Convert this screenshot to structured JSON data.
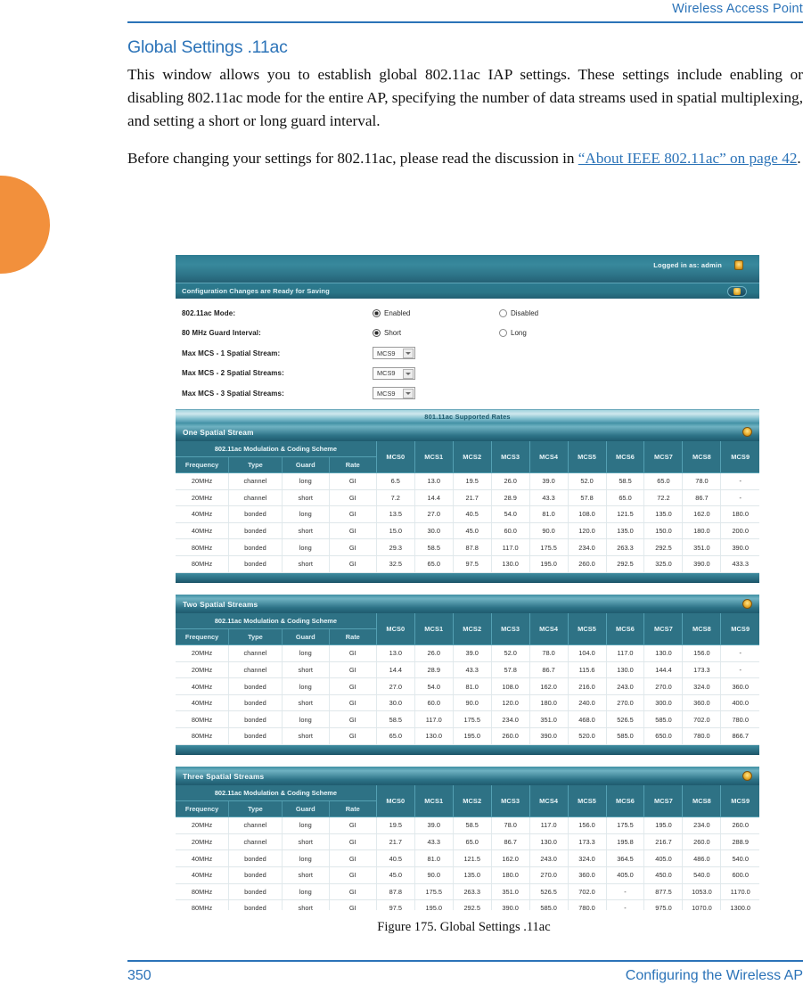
{
  "page": {
    "running_head": "Wireless Access Point",
    "section_title": "Global Settings .11ac",
    "paragraph_1": "This window allows you to establish global 802.11ac IAP settings. These settings include enabling or disabling 802.11ac mode for the entire AP, specifying the number of data streams used in spatial multiplexing, and setting a short or long guard interval.",
    "paragraph_2_pre": "Before changing your settings for 802.11ac, please read the discussion in ",
    "paragraph_2_link": "“About IEEE 802.11ac” on page 42",
    "paragraph_2_post": ".",
    "figure_caption": "Figure 175. Global Settings .11ac",
    "folio_number": "350",
    "folio_title": "Configuring the Wireless AP",
    "accent_color": "#2b73b8",
    "tab_color": "#f2903c"
  },
  "screenshot": {
    "topbar": {
      "logged_in_text": "Logged in as: admin",
      "lock_icon": "lock-icon"
    },
    "statusbar": {
      "text": "Configuration Changes are Ready for Saving",
      "save_button_icon": "save-icon"
    },
    "form": {
      "rows": [
        {
          "label": "802.11ac Mode:",
          "type": "radio",
          "options": [
            {
              "label": "Enabled",
              "selected": true
            },
            {
              "label": "Disabled",
              "selected": false
            }
          ]
        },
        {
          "label": "80 MHz Guard Interval:",
          "type": "radio",
          "options": [
            {
              "label": "Short",
              "selected": true
            },
            {
              "label": "Long",
              "selected": false
            }
          ]
        },
        {
          "label": "Max MCS - 1 Spatial Stream:",
          "type": "select",
          "value": "MCS9"
        },
        {
          "label": "Max MCS - 2 Spatial Streams:",
          "type": "select",
          "value": "MCS9"
        },
        {
          "label": "Max MCS - 3 Spatial Streams:",
          "type": "select",
          "value": "MCS9"
        }
      ]
    },
    "rates_banner": "801.11ac Supported Rates",
    "table_group_header": "802.11ac Modulation & Coding Scheme",
    "sub_headers": [
      "Frequency",
      "Type",
      "Guard",
      "Rate"
    ],
    "mcs_headers": [
      "MCS0",
      "MCS1",
      "MCS2",
      "MCS3",
      "MCS4",
      "MCS5",
      "MCS6",
      "MCS7",
      "MCS8",
      "MCS9"
    ],
    "sections": [
      {
        "title": "One Spatial Stream",
        "gear_icon": "gear-icon",
        "rows": [
          {
            "freq": "20MHz",
            "type": "channel",
            "guard": "long",
            "rate": "GI",
            "values": [
              "6.5",
              "13.0",
              "19.5",
              "26.0",
              "39.0",
              "52.0",
              "58.5",
              "65.0",
              "78.0",
              "-"
            ]
          },
          {
            "freq": "20MHz",
            "type": "channel",
            "guard": "short",
            "rate": "GI",
            "values": [
              "7.2",
              "14.4",
              "21.7",
              "28.9",
              "43.3",
              "57.8",
              "65.0",
              "72.2",
              "86.7",
              "-"
            ]
          },
          {
            "freq": "40MHz",
            "type": "bonded",
            "guard": "long",
            "rate": "GI",
            "values": [
              "13.5",
              "27.0",
              "40.5",
              "54.0",
              "81.0",
              "108.0",
              "121.5",
              "135.0",
              "162.0",
              "180.0"
            ]
          },
          {
            "freq": "40MHz",
            "type": "bonded",
            "guard": "short",
            "rate": "GI",
            "values": [
              "15.0",
              "30.0",
              "45.0",
              "60.0",
              "90.0",
              "120.0",
              "135.0",
              "150.0",
              "180.0",
              "200.0"
            ]
          },
          {
            "freq": "80MHz",
            "type": "bonded",
            "guard": "long",
            "rate": "GI",
            "values": [
              "29.3",
              "58.5",
              "87.8",
              "117.0",
              "175.5",
              "234.0",
              "263.3",
              "292.5",
              "351.0",
              "390.0"
            ]
          },
          {
            "freq": "80MHz",
            "type": "bonded",
            "guard": "short",
            "rate": "GI",
            "values": [
              "32.5",
              "65.0",
              "97.5",
              "130.0",
              "195.0",
              "260.0",
              "292.5",
              "325.0",
              "390.0",
              "433.3"
            ]
          }
        ]
      },
      {
        "title": "Two Spatial Streams",
        "gear_icon": "gear-icon",
        "rows": [
          {
            "freq": "20MHz",
            "type": "channel",
            "guard": "long",
            "rate": "GI",
            "values": [
              "13.0",
              "26.0",
              "39.0",
              "52.0",
              "78.0",
              "104.0",
              "117.0",
              "130.0",
              "156.0",
              "-"
            ]
          },
          {
            "freq": "20MHz",
            "type": "channel",
            "guard": "short",
            "rate": "GI",
            "values": [
              "14.4",
              "28.9",
              "43.3",
              "57.8",
              "86.7",
              "115.6",
              "130.0",
              "144.4",
              "173.3",
              "-"
            ]
          },
          {
            "freq": "40MHz",
            "type": "bonded",
            "guard": "long",
            "rate": "GI",
            "values": [
              "27.0",
              "54.0",
              "81.0",
              "108.0",
              "162.0",
              "216.0",
              "243.0",
              "270.0",
              "324.0",
              "360.0"
            ]
          },
          {
            "freq": "40MHz",
            "type": "bonded",
            "guard": "short",
            "rate": "GI",
            "values": [
              "30.0",
              "60.0",
              "90.0",
              "120.0",
              "180.0",
              "240.0",
              "270.0",
              "300.0",
              "360.0",
              "400.0"
            ]
          },
          {
            "freq": "80MHz",
            "type": "bonded",
            "guard": "long",
            "rate": "GI",
            "values": [
              "58.5",
              "117.0",
              "175.5",
              "234.0",
              "351.0",
              "468.0",
              "526.5",
              "585.0",
              "702.0",
              "780.0"
            ]
          },
          {
            "freq": "80MHz",
            "type": "bonded",
            "guard": "short",
            "rate": "GI",
            "values": [
              "65.0",
              "130.0",
              "195.0",
              "260.0",
              "390.0",
              "520.0",
              "585.0",
              "650.0",
              "780.0",
              "866.7"
            ]
          }
        ]
      },
      {
        "title": "Three Spatial Streams",
        "gear_icon": "gear-icon",
        "rows": [
          {
            "freq": "20MHz",
            "type": "channel",
            "guard": "long",
            "rate": "GI",
            "values": [
              "19.5",
              "39.0",
              "58.5",
              "78.0",
              "117.0",
              "156.0",
              "175.5",
              "195.0",
              "234.0",
              "260.0"
            ]
          },
          {
            "freq": "20MHz",
            "type": "channel",
            "guard": "short",
            "rate": "GI",
            "values": [
              "21.7",
              "43.3",
              "65.0",
              "86.7",
              "130.0",
              "173.3",
              "195.8",
              "216.7",
              "260.0",
              "288.9"
            ]
          },
          {
            "freq": "40MHz",
            "type": "bonded",
            "guard": "long",
            "rate": "GI",
            "values": [
              "40.5",
              "81.0",
              "121.5",
              "162.0",
              "243.0",
              "324.0",
              "364.5",
              "405.0",
              "486.0",
              "540.0"
            ]
          },
          {
            "freq": "40MHz",
            "type": "bonded",
            "guard": "short",
            "rate": "GI",
            "values": [
              "45.0",
              "90.0",
              "135.0",
              "180.0",
              "270.0",
              "360.0",
              "405.0",
              "450.0",
              "540.0",
              "600.0"
            ]
          },
          {
            "freq": "80MHz",
            "type": "bonded",
            "guard": "long",
            "rate": "GI",
            "values": [
              "87.8",
              "175.5",
              "263.3",
              "351.0",
              "526.5",
              "702.0",
              "-",
              "877.5",
              "1053.0",
              "1170.0"
            ]
          },
          {
            "freq": "80MHz",
            "type": "bonded",
            "guard": "short",
            "rate": "GI",
            "values": [
              "97.5",
              "195.0",
              "292.5",
              "390.0",
              "585.0",
              "780.0",
              "-",
              "975.0",
              "1070.0",
              "1300.0"
            ]
          }
        ]
      }
    ]
  }
}
